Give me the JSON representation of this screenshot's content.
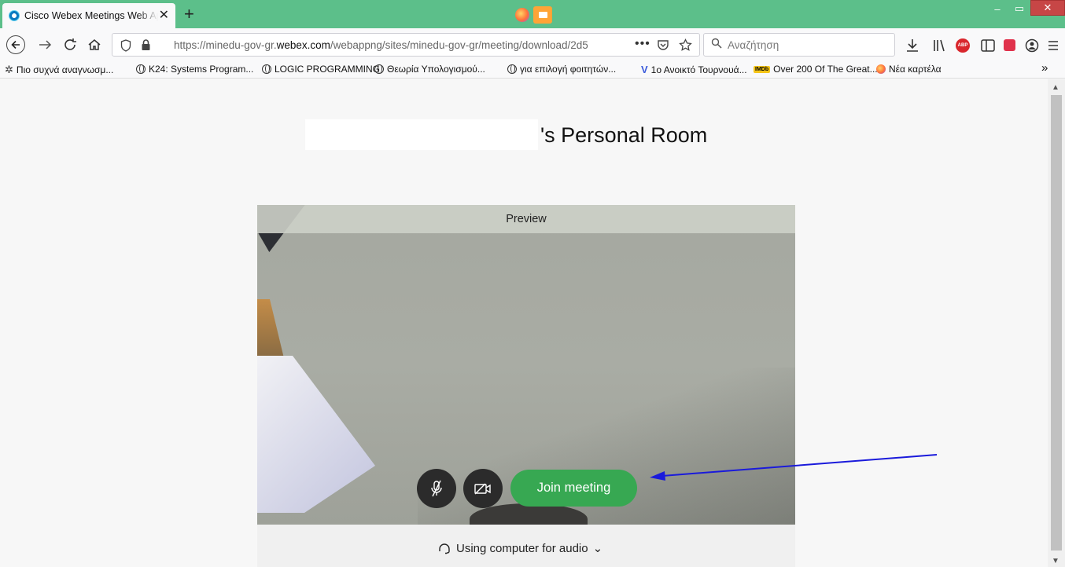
{
  "browser": {
    "tab_title": "Cisco Webex Meetings Web App",
    "tab_close": "✕",
    "new_tab": "+",
    "url_prefix": "https://minedu-gov-gr.",
    "url_domain": "webex.com",
    "url_path": "/webappng/sites/minedu-gov-gr/meeting/download/2d5",
    "url_more": "•••",
    "search_placeholder": "Αναζήτηση",
    "win_minimize": "–",
    "win_restore": "▭",
    "win_close": "✕"
  },
  "bookmarks": [
    {
      "label": "Πιο συχνά αναγνωσμ...",
      "icon": "gear-icon"
    },
    {
      "label": "K24: Systems Program...",
      "icon": "globe-icon"
    },
    {
      "label": "LOGIC PROGRAMMING",
      "icon": "globe-icon"
    },
    {
      "label": "Θεωρία Υπολογισμού...",
      "icon": "globe-icon"
    },
    {
      "label": "για επιλογή φοιτητών...",
      "icon": "globe-icon"
    },
    {
      "label": "1ο Ανοικτό Τουρνουά...",
      "icon": "v-icon"
    },
    {
      "label": "Over 200 Of The Great...",
      "icon": "imdb-icon"
    },
    {
      "label": "Νέα καρτέλα",
      "icon": "firefox-icon"
    }
  ],
  "bookmarks_overflow": "»",
  "imdb_badge": "IMDb",
  "page": {
    "room_title": "'s Personal Room",
    "preview_label": "Preview",
    "join_label": "Join meeting",
    "audio_label": "Using computer for audio",
    "audio_chevron": "⌄"
  },
  "colors": {
    "tabstrip": "#5cbf8a",
    "join_button": "#37a852",
    "annotation_arrow": "#1a1adb"
  }
}
